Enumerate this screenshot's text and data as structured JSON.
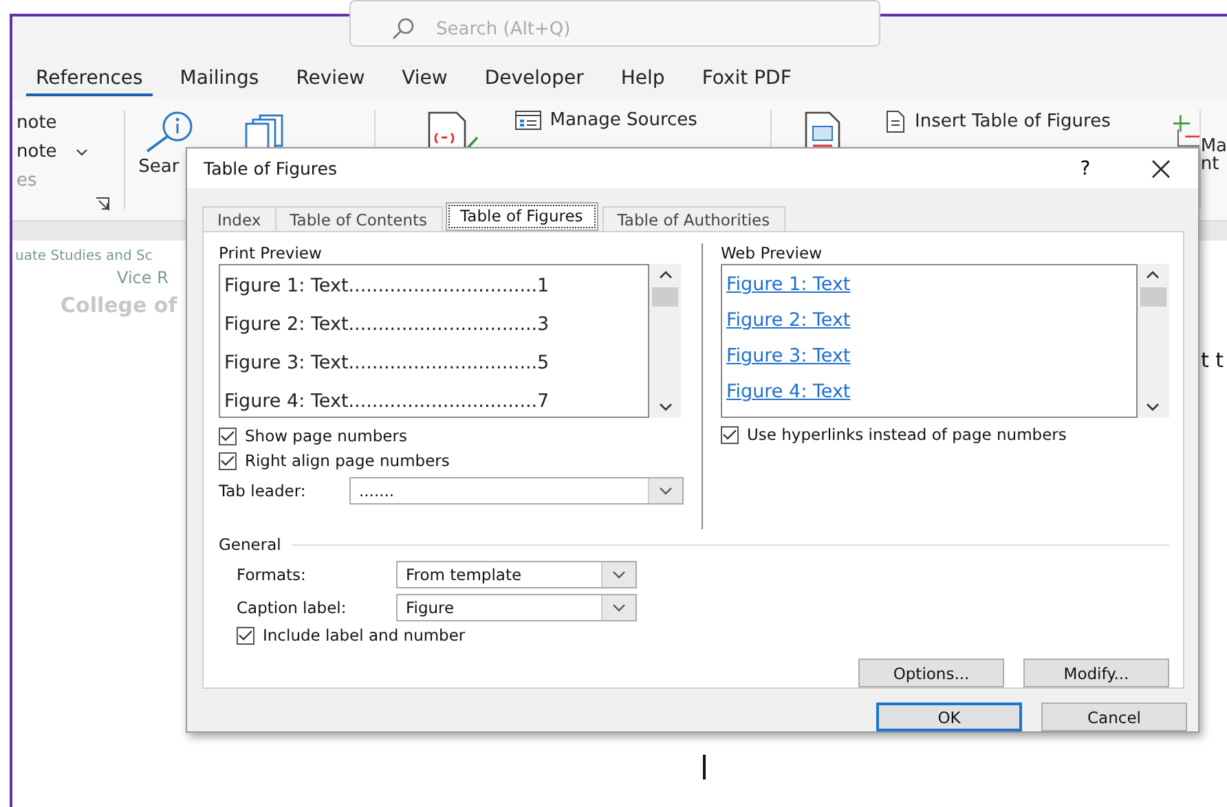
{
  "search": {
    "placeholder": "Search (Alt+Q)"
  },
  "ribbon_tabs": [
    {
      "label": "References",
      "selected": true
    },
    {
      "label": "Mailings",
      "selected": false
    },
    {
      "label": "Review",
      "selected": false
    },
    {
      "label": "View",
      "selected": false
    },
    {
      "label": "Developer",
      "selected": false
    },
    {
      "label": "Help",
      "selected": false
    },
    {
      "label": "Foxit PDF",
      "selected": false
    }
  ],
  "ribbon": {
    "footnote_lines": [
      "note",
      "note"
    ],
    "faded_label": "es",
    "search_label": "Sear",
    "manage_sources": "Manage Sources",
    "insert_table_of_figures": "Insert Table of Figures",
    "right_cut": [
      "Ma",
      "nt"
    ]
  },
  "document": {
    "lines": [
      "uate Studies and Sc",
      "Vice R",
      "College of"
    ],
    "right_fragment": "t t"
  },
  "dialog": {
    "title": "Table of Figures",
    "help": "?",
    "tabs": [
      {
        "label": "Index",
        "selected": false
      },
      {
        "label": "Table of Contents",
        "selected": false
      },
      {
        "label": "Table of Figures",
        "selected": true
      },
      {
        "label": "Table of Authorities",
        "selected": false
      }
    ],
    "print_preview": {
      "label": "Print Preview",
      "entries": [
        "Figure 1: Text................................1",
        "Figure 2: Text................................3",
        "Figure 3: Text................................5",
        "Figure 4: Text................................7"
      ]
    },
    "show_page_numbers": {
      "label": "Show page numbers",
      "checked": true
    },
    "right_align": {
      "label": "Right align page numbers",
      "checked": true
    },
    "tab_leader": {
      "label": "Tab leader:",
      "value": "......."
    },
    "web_preview": {
      "label": "Web Preview",
      "entries": [
        "Figure 1: Text",
        "Figure 2: Text",
        "Figure 3: Text",
        "Figure 4: Text"
      ]
    },
    "use_hyperlinks": {
      "label": "Use hyperlinks instead of page numbers",
      "checked": true
    },
    "general": {
      "label": "General",
      "formats": {
        "label": "Formats:",
        "value": "From template"
      },
      "caption_label": {
        "label": "Caption label:",
        "value": "Figure"
      },
      "include_label": {
        "label": "Include label and number",
        "checked": true
      }
    },
    "buttons": [
      {
        "label": "Options..."
      },
      {
        "label": "Modify..."
      }
    ],
    "footer_buttons": [
      {
        "label": "OK",
        "kind": "default"
      },
      {
        "label": "Cancel",
        "kind": "normal"
      }
    ]
  }
}
